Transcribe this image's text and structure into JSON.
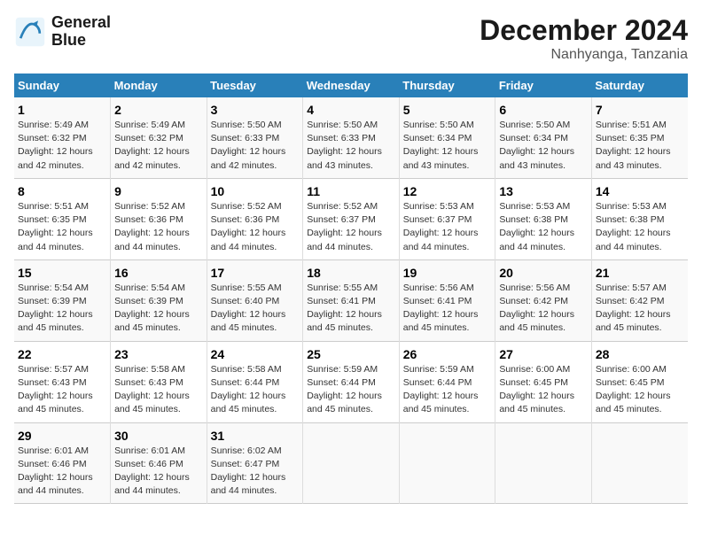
{
  "logo": {
    "line1": "General",
    "line2": "Blue"
  },
  "title": "December 2024",
  "subtitle": "Nanhyanga, Tanzania",
  "days_of_week": [
    "Sunday",
    "Monday",
    "Tuesday",
    "Wednesday",
    "Thursday",
    "Friday",
    "Saturday"
  ],
  "weeks": [
    [
      {
        "day": "1",
        "sunrise": "5:49 AM",
        "sunset": "6:32 PM",
        "daylight": "12 hours and 42 minutes."
      },
      {
        "day": "2",
        "sunrise": "5:49 AM",
        "sunset": "6:32 PM",
        "daylight": "12 hours and 42 minutes."
      },
      {
        "day": "3",
        "sunrise": "5:50 AM",
        "sunset": "6:33 PM",
        "daylight": "12 hours and 42 minutes."
      },
      {
        "day": "4",
        "sunrise": "5:50 AM",
        "sunset": "6:33 PM",
        "daylight": "12 hours and 43 minutes."
      },
      {
        "day": "5",
        "sunrise": "5:50 AM",
        "sunset": "6:34 PM",
        "daylight": "12 hours and 43 minutes."
      },
      {
        "day": "6",
        "sunrise": "5:50 AM",
        "sunset": "6:34 PM",
        "daylight": "12 hours and 43 minutes."
      },
      {
        "day": "7",
        "sunrise": "5:51 AM",
        "sunset": "6:35 PM",
        "daylight": "12 hours and 43 minutes."
      }
    ],
    [
      {
        "day": "8",
        "sunrise": "5:51 AM",
        "sunset": "6:35 PM",
        "daylight": "12 hours and 44 minutes."
      },
      {
        "day": "9",
        "sunrise": "5:52 AM",
        "sunset": "6:36 PM",
        "daylight": "12 hours and 44 minutes."
      },
      {
        "day": "10",
        "sunrise": "5:52 AM",
        "sunset": "6:36 PM",
        "daylight": "12 hours and 44 minutes."
      },
      {
        "day": "11",
        "sunrise": "5:52 AM",
        "sunset": "6:37 PM",
        "daylight": "12 hours and 44 minutes."
      },
      {
        "day": "12",
        "sunrise": "5:53 AM",
        "sunset": "6:37 PM",
        "daylight": "12 hours and 44 minutes."
      },
      {
        "day": "13",
        "sunrise": "5:53 AM",
        "sunset": "6:38 PM",
        "daylight": "12 hours and 44 minutes."
      },
      {
        "day": "14",
        "sunrise": "5:53 AM",
        "sunset": "6:38 PM",
        "daylight": "12 hours and 44 minutes."
      }
    ],
    [
      {
        "day": "15",
        "sunrise": "5:54 AM",
        "sunset": "6:39 PM",
        "daylight": "12 hours and 45 minutes."
      },
      {
        "day": "16",
        "sunrise": "5:54 AM",
        "sunset": "6:39 PM",
        "daylight": "12 hours and 45 minutes."
      },
      {
        "day": "17",
        "sunrise": "5:55 AM",
        "sunset": "6:40 PM",
        "daylight": "12 hours and 45 minutes."
      },
      {
        "day": "18",
        "sunrise": "5:55 AM",
        "sunset": "6:41 PM",
        "daylight": "12 hours and 45 minutes."
      },
      {
        "day": "19",
        "sunrise": "5:56 AM",
        "sunset": "6:41 PM",
        "daylight": "12 hours and 45 minutes."
      },
      {
        "day": "20",
        "sunrise": "5:56 AM",
        "sunset": "6:42 PM",
        "daylight": "12 hours and 45 minutes."
      },
      {
        "day": "21",
        "sunrise": "5:57 AM",
        "sunset": "6:42 PM",
        "daylight": "12 hours and 45 minutes."
      }
    ],
    [
      {
        "day": "22",
        "sunrise": "5:57 AM",
        "sunset": "6:43 PM",
        "daylight": "12 hours and 45 minutes."
      },
      {
        "day": "23",
        "sunrise": "5:58 AM",
        "sunset": "6:43 PM",
        "daylight": "12 hours and 45 minutes."
      },
      {
        "day": "24",
        "sunrise": "5:58 AM",
        "sunset": "6:44 PM",
        "daylight": "12 hours and 45 minutes."
      },
      {
        "day": "25",
        "sunrise": "5:59 AM",
        "sunset": "6:44 PM",
        "daylight": "12 hours and 45 minutes."
      },
      {
        "day": "26",
        "sunrise": "5:59 AM",
        "sunset": "6:44 PM",
        "daylight": "12 hours and 45 minutes."
      },
      {
        "day": "27",
        "sunrise": "6:00 AM",
        "sunset": "6:45 PM",
        "daylight": "12 hours and 45 minutes."
      },
      {
        "day": "28",
        "sunrise": "6:00 AM",
        "sunset": "6:45 PM",
        "daylight": "12 hours and 45 minutes."
      }
    ],
    [
      {
        "day": "29",
        "sunrise": "6:01 AM",
        "sunset": "6:46 PM",
        "daylight": "12 hours and 44 minutes."
      },
      {
        "day": "30",
        "sunrise": "6:01 AM",
        "sunset": "6:46 PM",
        "daylight": "12 hours and 44 minutes."
      },
      {
        "day": "31",
        "sunrise": "6:02 AM",
        "sunset": "6:47 PM",
        "daylight": "12 hours and 44 minutes."
      },
      null,
      null,
      null,
      null
    ]
  ]
}
